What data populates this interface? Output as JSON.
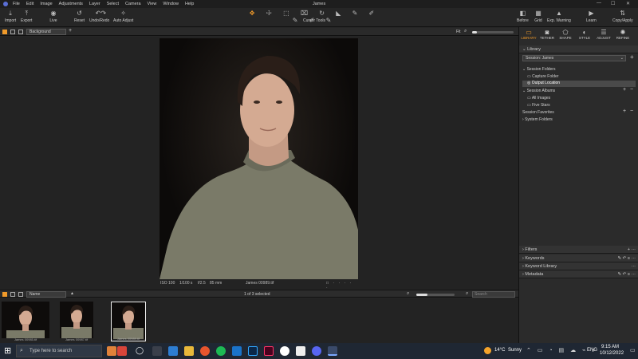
{
  "menu": {
    "items": [
      "File",
      "Edit",
      "Image",
      "Adjustments",
      "Layer",
      "Select",
      "Camera",
      "View",
      "Window",
      "Help"
    ],
    "window_title": "James",
    "controls": [
      "—",
      "☐",
      "✕"
    ]
  },
  "toolbar": {
    "import": "Import",
    "export": "Export",
    "live": "Live",
    "reset": "Reset",
    "undo_redo": "Undo/Redo",
    "auto_adjust": "Auto Adjust",
    "cursor_tools": "Cursor Tools",
    "before": "Before",
    "grid": "Grid",
    "exp_warning": "Exp. Warning",
    "learn": "Learn",
    "copy_apply": "Copy/Apply"
  },
  "viewbar": {
    "background_select": "Background",
    "fit": "Fit"
  },
  "image_info": {
    "iso": "ISO 100",
    "shutter": "1/100 s",
    "aperture": "f/2.5",
    "focal": "85 mm",
    "filename": "James 00989.tif"
  },
  "filmstrip": {
    "sort": "Name",
    "count": "1 of 3 selected",
    "search_placeholder": "Search",
    "thumbs": [
      {
        "label": "James 00985.tif"
      },
      {
        "label": "James 00987.tif"
      },
      {
        "label": "James 00989.tif"
      }
    ]
  },
  "right_panel": {
    "tabs": [
      "LIBRARY",
      "TETHER",
      "SHAPE",
      "STYLE",
      "ADJUST",
      "REFINE"
    ],
    "active_tab": "LIBRARY",
    "library_title": "Library",
    "session_select": "Session: James",
    "session_folders": "Session Folders",
    "capture_folder": "Capture Folder",
    "output_location": "Output Location",
    "session_albums": "Session Albums",
    "all_images": "All Images",
    "five_stars": "Five Stars",
    "session_favorites": "Session Favorites",
    "system_folders": "System Folders",
    "filters": "Filters",
    "keywords": "Keywords",
    "keyword_library": "Keyword Library",
    "metadata": "Metadata"
  },
  "taskbar": {
    "search_placeholder": "Type here to search",
    "weather_temp": "14°C",
    "weather_text": "Sunny",
    "lang": "ENG",
    "time": "9:15 AM",
    "date": "10/12/2022"
  },
  "colors": {
    "accent": "#f09a2a",
    "taskbar": "#1f2733"
  }
}
